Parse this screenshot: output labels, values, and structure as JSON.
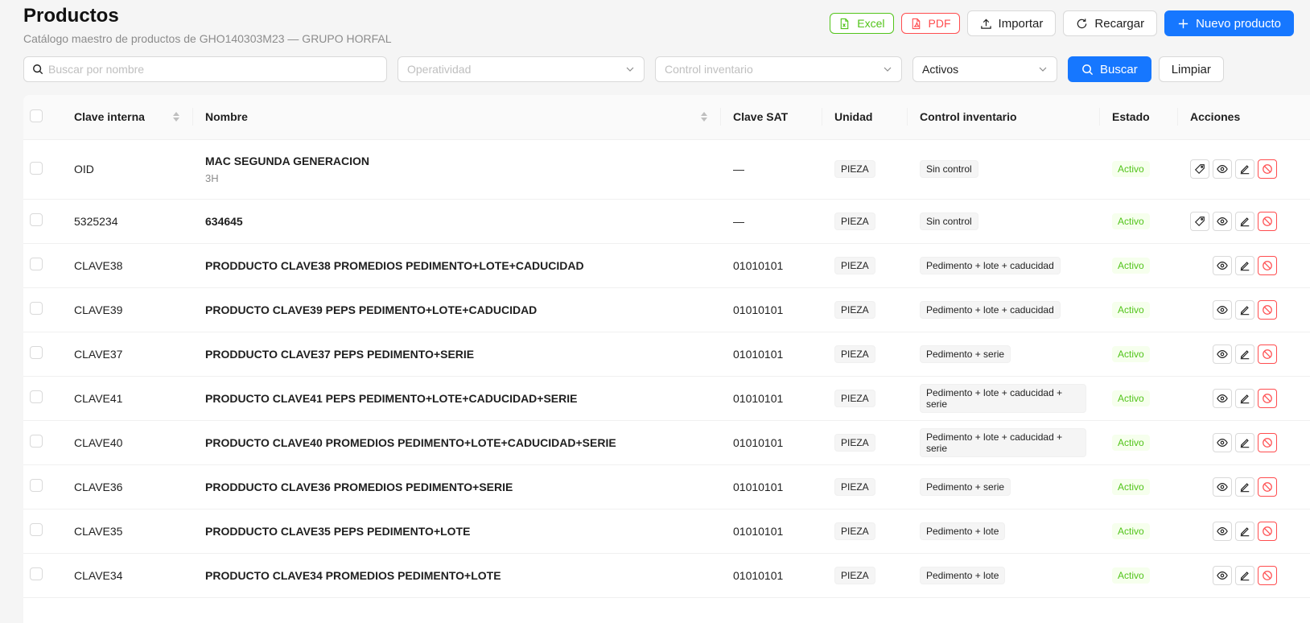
{
  "page": {
    "title": "Productos",
    "subtitle": "Catálogo maestro de productos de GHO140303M23 — GRUPO HORFAL"
  },
  "toolbar": {
    "excel": "Excel",
    "pdf": "PDF",
    "import": "Importar",
    "reload": "Recargar",
    "new_product": "Nuevo producto"
  },
  "filters": {
    "search_placeholder": "Buscar por nombre",
    "operatividad_placeholder": "Operatividad",
    "control_placeholder": "Control inventario",
    "estado_value": "Activos",
    "search_button": "Buscar",
    "clear_button": "Limpiar"
  },
  "table": {
    "columns": {
      "clave": "Clave interna",
      "nombre": "Nombre",
      "sat": "Clave SAT",
      "unidad": "Unidad",
      "control": "Control inventario",
      "estado": "Estado",
      "acciones": "Acciones"
    },
    "rows": [
      {
        "clave": "OID",
        "nombre": "MAC SEGUNDA GENERACION",
        "sub": "3H",
        "sat": "—",
        "unidad": "PIEZA",
        "control": "Sin control",
        "estado": "Activo",
        "tag_action": true
      },
      {
        "clave": "5325234",
        "nombre": "634645",
        "sub": "",
        "sat": "—",
        "unidad": "PIEZA",
        "control": "Sin control",
        "estado": "Activo",
        "tag_action": true
      },
      {
        "clave": "CLAVE38",
        "nombre": "PRODDUCTO CLAVE38 PROMEDIOS PEDIMENTO+LOTE+CADUCIDAD",
        "sub": "",
        "sat": "01010101",
        "unidad": "PIEZA",
        "control": "Pedimento + lote + caducidad",
        "estado": "Activo",
        "tag_action": false
      },
      {
        "clave": "CLAVE39",
        "nombre": "PRODUCTO CLAVE39 PEPS PEDIMENTO+LOTE+CADUCIDAD",
        "sub": "",
        "sat": "01010101",
        "unidad": "PIEZA",
        "control": "Pedimento + lote + caducidad",
        "estado": "Activo",
        "tag_action": false
      },
      {
        "clave": "CLAVE37",
        "nombre": "PRODDUCTO CLAVE37 PEPS PEDIMENTO+SERIE",
        "sub": "",
        "sat": "01010101",
        "unidad": "PIEZA",
        "control": "Pedimento + serie",
        "estado": "Activo",
        "tag_action": false
      },
      {
        "clave": "CLAVE41",
        "nombre": "PRODUCTO CLAVE41 PEPS PEDIMENTO+LOTE+CADUCIDAD+SERIE",
        "sub": "",
        "sat": "01010101",
        "unidad": "PIEZA",
        "control": "Pedimento + lote + caducidad + serie",
        "estado": "Activo",
        "tag_action": false
      },
      {
        "clave": "CLAVE40",
        "nombre": "PRODUCTO CLAVE40 PROMEDIOS PEDIMENTO+LOTE+CADUCIDAD+SERIE",
        "sub": "",
        "sat": "01010101",
        "unidad": "PIEZA",
        "control": "Pedimento + lote + caducidad + serie",
        "estado": "Activo",
        "tag_action": false
      },
      {
        "clave": "CLAVE36",
        "nombre": "PRODDUCTO CLAVE36 PROMEDIOS PEDIMENTO+SERIE",
        "sub": "",
        "sat": "01010101",
        "unidad": "PIEZA",
        "control": "Pedimento + serie",
        "estado": "Activo",
        "tag_action": false
      },
      {
        "clave": "CLAVE35",
        "nombre": "PRODDUCTO CLAVE35 PEPS PEDIMENTO+LOTE",
        "sub": "",
        "sat": "01010101",
        "unidad": "PIEZA",
        "control": "Pedimento + lote",
        "estado": "Activo",
        "tag_action": false
      },
      {
        "clave": "CLAVE34",
        "nombre": "PRODUCTO CLAVE34 PROMEDIOS PEDIMENTO+LOTE",
        "sub": "",
        "sat": "01010101",
        "unidad": "PIEZA",
        "control": "Pedimento + lote",
        "estado": "Activo",
        "tag_action": false
      }
    ]
  },
  "colors": {
    "primary": "#1677ff",
    "excel": "#52c41a",
    "pdf": "#ff4d4f",
    "status_active": "#52c41a",
    "danger": "#ff4d4f"
  },
  "icons": {
    "excel": "file-excel-icon",
    "pdf": "file-pdf-icon",
    "import": "upload-icon",
    "reload": "reload-icon",
    "new": "plus-icon",
    "search": "search-icon",
    "dropdown": "chevron-down-icon",
    "tag_action": "tag-icon",
    "view": "eye-icon",
    "edit": "edit-icon",
    "disable": "stop-icon"
  }
}
